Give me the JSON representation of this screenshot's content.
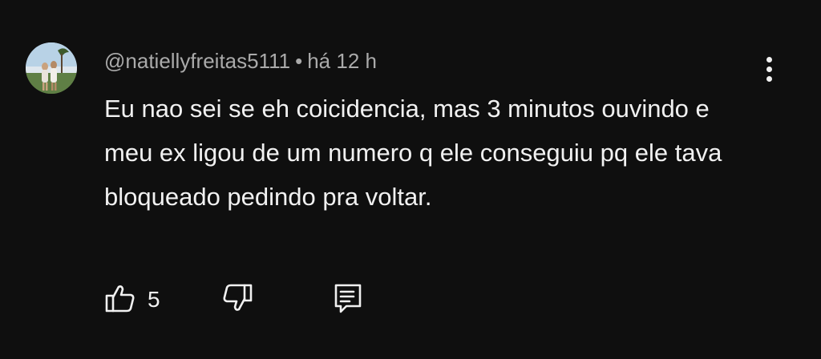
{
  "comment": {
    "author": "@natiellyfreitas5111",
    "separator": "•",
    "time": "há 12 h",
    "text": "Eu nao sei se eh coicidencia, mas 3 minutos ouvindo e meu ex ligou de um numero q ele conseguiu pq ele tava bloqueado pedindo pra voltar.",
    "like_count": "5"
  },
  "icons": {
    "more": "more-vertical-icon",
    "like": "thumbs-up-icon",
    "dislike": "thumbs-down-icon",
    "reply": "reply-comment-icon"
  },
  "colors": {
    "background": "#0f0f0f",
    "text_primary": "#f1f1f1",
    "text_secondary": "#aaaaaa"
  }
}
